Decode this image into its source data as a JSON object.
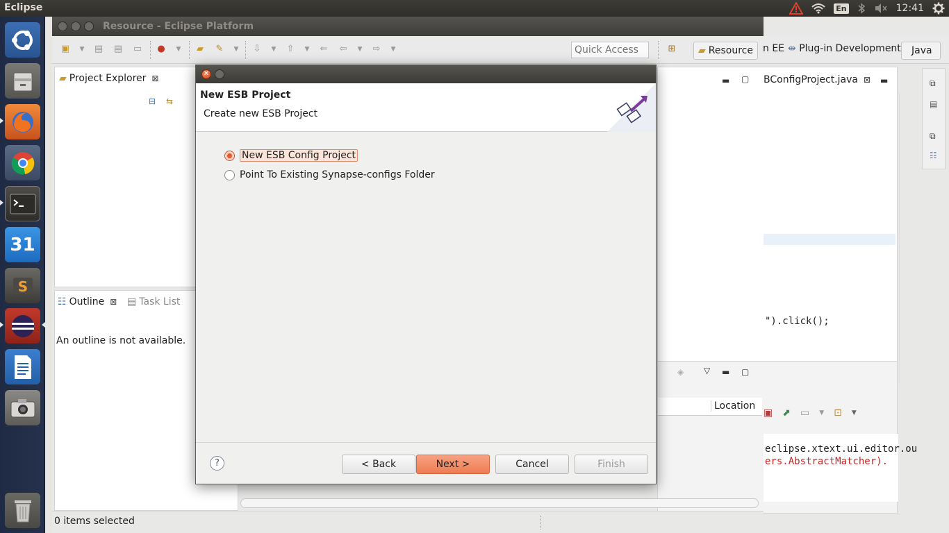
{
  "top_panel": {
    "app_name": "Eclipse",
    "keyboard_layout": "En",
    "clock": "12:41",
    "icons": [
      "warning-icon",
      "wifi-icon",
      "bluetooth-icon",
      "volume-mute-icon",
      "settings-gear-icon"
    ]
  },
  "launcher": {
    "items": [
      "ubuntu-dash",
      "files",
      "firefox",
      "chrome",
      "terminal",
      "calendar",
      "sublime-text",
      "eclipse",
      "libreoffice-writer",
      "camera",
      "trash"
    ],
    "calendar_day": "31"
  },
  "eclipse": {
    "window_title": "Resource - Eclipse Platform",
    "quick_access_placeholder": "Quick Access",
    "perspectives": {
      "resource": "Resource",
      "ee_partial": "n EE",
      "plugin": "Plug-in Development",
      "java": "Java"
    },
    "project_explorer_tab": "Project Explorer",
    "outline_tab": "Outline",
    "task_list_tab": "Task List",
    "outline_message": "An outline is not available.",
    "editor_tab": "BConfigProject.java",
    "editor_code_line": "\").click();",
    "problems_location_header": "Location",
    "console_line1": "eclipse.xtext.ui.editor.ou",
    "console_line2": "ers.AbstractMatcher).",
    "status_text": "0 items selected"
  },
  "dialog": {
    "title": "New ESB Project",
    "subtitle": "Create new ESB Project",
    "options": [
      {
        "label": "New ESB Config Project",
        "checked": true
      },
      {
        "label": "Point To Existing Synapse-configs Folder",
        "checked": false
      }
    ],
    "buttons": {
      "back": "< Back",
      "next": "Next >",
      "cancel": "Cancel",
      "finish": "Finish"
    },
    "help": "?"
  },
  "colors": {
    "accent": "#ef7c52",
    "launcher_bg": "#1f2a44",
    "titlebar": "#3e3d39"
  }
}
